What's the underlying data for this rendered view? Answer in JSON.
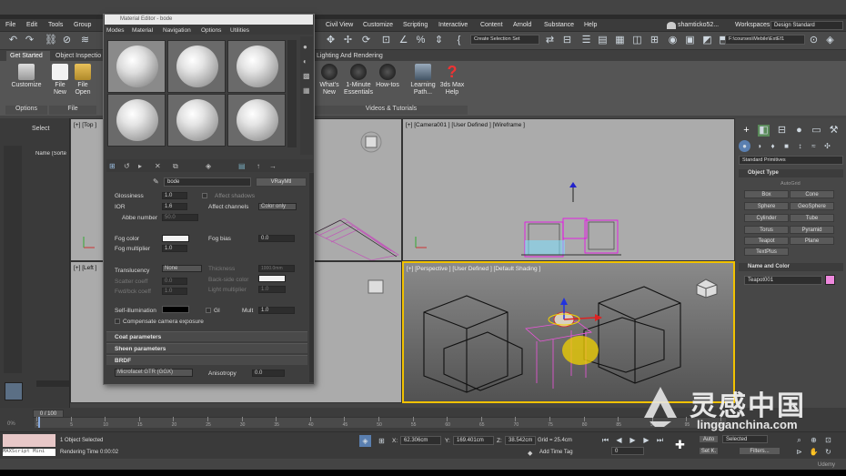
{
  "menu": [
    "File",
    "Edit",
    "Tools",
    "Group",
    "Civil View",
    "Customize",
    "Scripting",
    "Interactive",
    "Content",
    "Arnold",
    "Substance",
    "Help"
  ],
  "user": "shamticko52...",
  "workspaces_label": "Workspaces:",
  "workspace_value": "Design Standard",
  "path": "F:\\courses\\Mebile\\ExtEf1",
  "selection_set": "Create Selection Set",
  "ribbon_tabs": [
    "Get Started",
    "Object Inspectio",
    "Lighting And Rendering"
  ],
  "ribbon": {
    "buttons": [
      {
        "label": "Customize"
      },
      {
        "label": "File\nNew"
      },
      {
        "label": "File\nOpen"
      },
      {
        "label": "What's\nNew"
      },
      {
        "label": "1-Minute\nEssentials"
      },
      {
        "label": "How-tos"
      },
      {
        "label": "Learning\nPath..."
      },
      {
        "label": "3ds Max\nHelp"
      }
    ],
    "groups": [
      "Options",
      "File",
      "Videos & Tutorials"
    ]
  },
  "explorer": {
    "select": "Select",
    "column": "Name (Sorte"
  },
  "viewports": {
    "tl": "[+] [Top ]",
    "tr": "[+] [Camera001 ] [User Defined ] [Wireframe ]",
    "bl": "[+] [Left ]",
    "br": "[+] [Perspective ] [User Defined ] [Default Shading ]"
  },
  "material_editor": {
    "title": "Material Editor - bode",
    "menu": [
      "Modes",
      "Material",
      "Navigation",
      "Options",
      "Utilities"
    ],
    "mat_name": "bode",
    "mat_type": "VRayMtl",
    "params": [
      {
        "label": "Glossiness",
        "value": "1.0"
      },
      {
        "label": "IOR",
        "value": "1.6"
      },
      {
        "label": "Abbe number",
        "value": "50.0"
      },
      {
        "label": "Fog color",
        "value": ""
      },
      {
        "label": "Fog multiplier",
        "value": "1.0"
      },
      {
        "label": "Translucency",
        "value": "None"
      },
      {
        "label": "Scatter coeff",
        "value": "0.0"
      },
      {
        "label": "Fwd/bck coeff",
        "value": "1.0"
      },
      {
        "label": "Self-illumination",
        "value": ""
      }
    ],
    "right_params": [
      {
        "label": "Affect shadows"
      },
      {
        "label": "Affect channels",
        "value": "Color only"
      },
      {
        "label": "Fog bias",
        "value": "0.0"
      },
      {
        "label": "Thickness",
        "value": "1000.0mm"
      },
      {
        "label": "Back-side color"
      },
      {
        "label": "Light multiplier",
        "value": "1.0"
      },
      {
        "label": "GI"
      },
      {
        "label": "Mult",
        "value": "1.0"
      }
    ],
    "comp_camera": "Compensate camera exposure",
    "rollouts": [
      "Coat parameters",
      "Sheen parameters",
      "BRDF"
    ],
    "brdf_type": "Microfacet GTR (GGX)",
    "anisotropy_label": "Anisotropy",
    "anisotropy_value": "0.0"
  },
  "command_panel": {
    "dropdown": "Standard Primitives",
    "object_type": "Object Type",
    "autogrid": "AutoGrid",
    "primitives": [
      "Box",
      "Cone",
      "Sphere",
      "GeoSphere",
      "Cylinder",
      "Tube",
      "Torus",
      "Pyramid",
      "Teapot",
      "Plane",
      "TextPlus"
    ],
    "name_color": "Name and Color",
    "object_name": "Teapot001"
  },
  "timeline": {
    "frame": "0 / 100",
    "ticks": [
      "0",
      "5",
      "10",
      "15",
      "20",
      "25",
      "30",
      "35",
      "40",
      "45",
      "50",
      "55",
      "60",
      "65",
      "70",
      "75",
      "80",
      "85",
      "90",
      "95",
      "100"
    ]
  },
  "status": {
    "maxscript": "MAXScript Mini",
    "selected": "1 Object Selected",
    "render_time": "Rendering Time  0:00:02",
    "x_label": "X:",
    "x": "62.306cm",
    "y_label": "Y:",
    "y": "169.401cm",
    "z_label": "Z:",
    "z": "38.542cm",
    "grid": "Grid = 25.4cm",
    "add_time_tag": "Add Time Tag",
    "auto": "Auto",
    "auto_sel": "Selected",
    "setk": "Set K.",
    "filters": "Filters...",
    "frame": "0"
  },
  "watermark": {
    "text": "灵感中国",
    "url": "lingganchina.com"
  },
  "udemy": "Udemy",
  "colors": {
    "accent": "#5aa0e6",
    "selection": "#ffd200",
    "object_color": "#ee88dd"
  }
}
